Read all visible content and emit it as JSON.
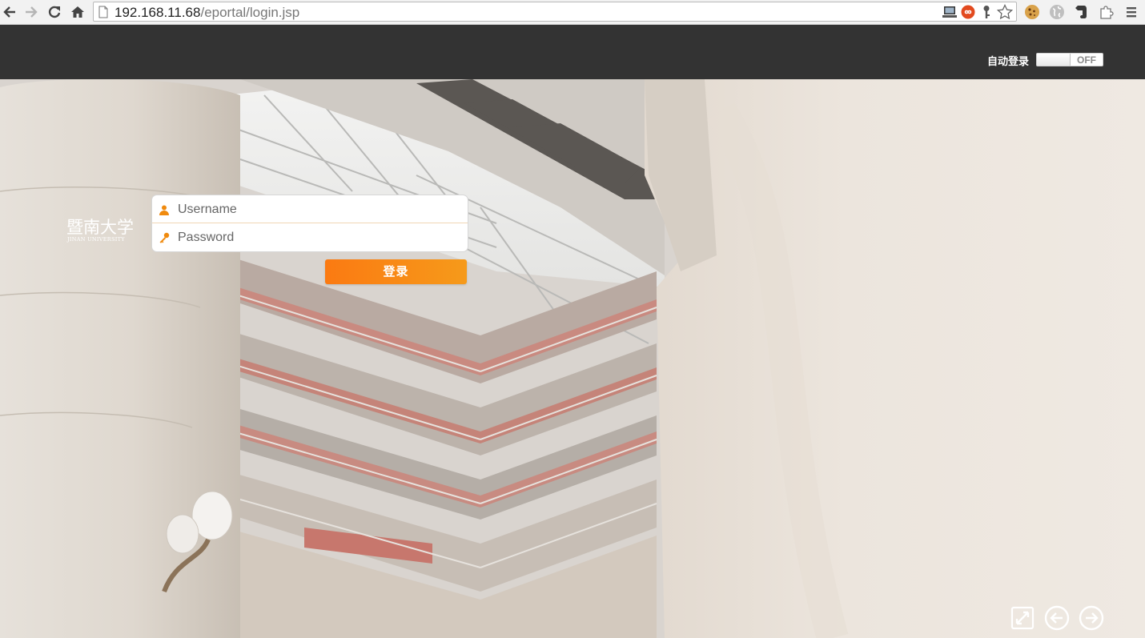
{
  "browser": {
    "url_host": "192.168.11.68",
    "url_path": "/eportal/login.jsp",
    "icons": [
      "back-icon",
      "forward-icon",
      "reload-icon",
      "home-icon",
      "page-icon",
      "monitor-icon",
      "infinity-icon",
      "key-icon",
      "star-icon",
      "cookie-icon",
      "globe-icon",
      "evernote-icon",
      "puzzle-icon",
      "menu-icon"
    ]
  },
  "header": {
    "auto_login_label": "自动登录",
    "toggle_state": "OFF"
  },
  "logo": {
    "text": "暨南大学",
    "subtext": "JINAN UNIVERSITY"
  },
  "login": {
    "username_placeholder": "Username",
    "password_placeholder": "Password",
    "submit_label": "登录"
  },
  "controls": {
    "icons": [
      "fullscreen-icon",
      "previous-slide-icon",
      "next-slide-icon"
    ]
  },
  "colors": {
    "header_bg": "#333333",
    "login_button": "#f7901a",
    "field_icon": "#f08a0e"
  }
}
